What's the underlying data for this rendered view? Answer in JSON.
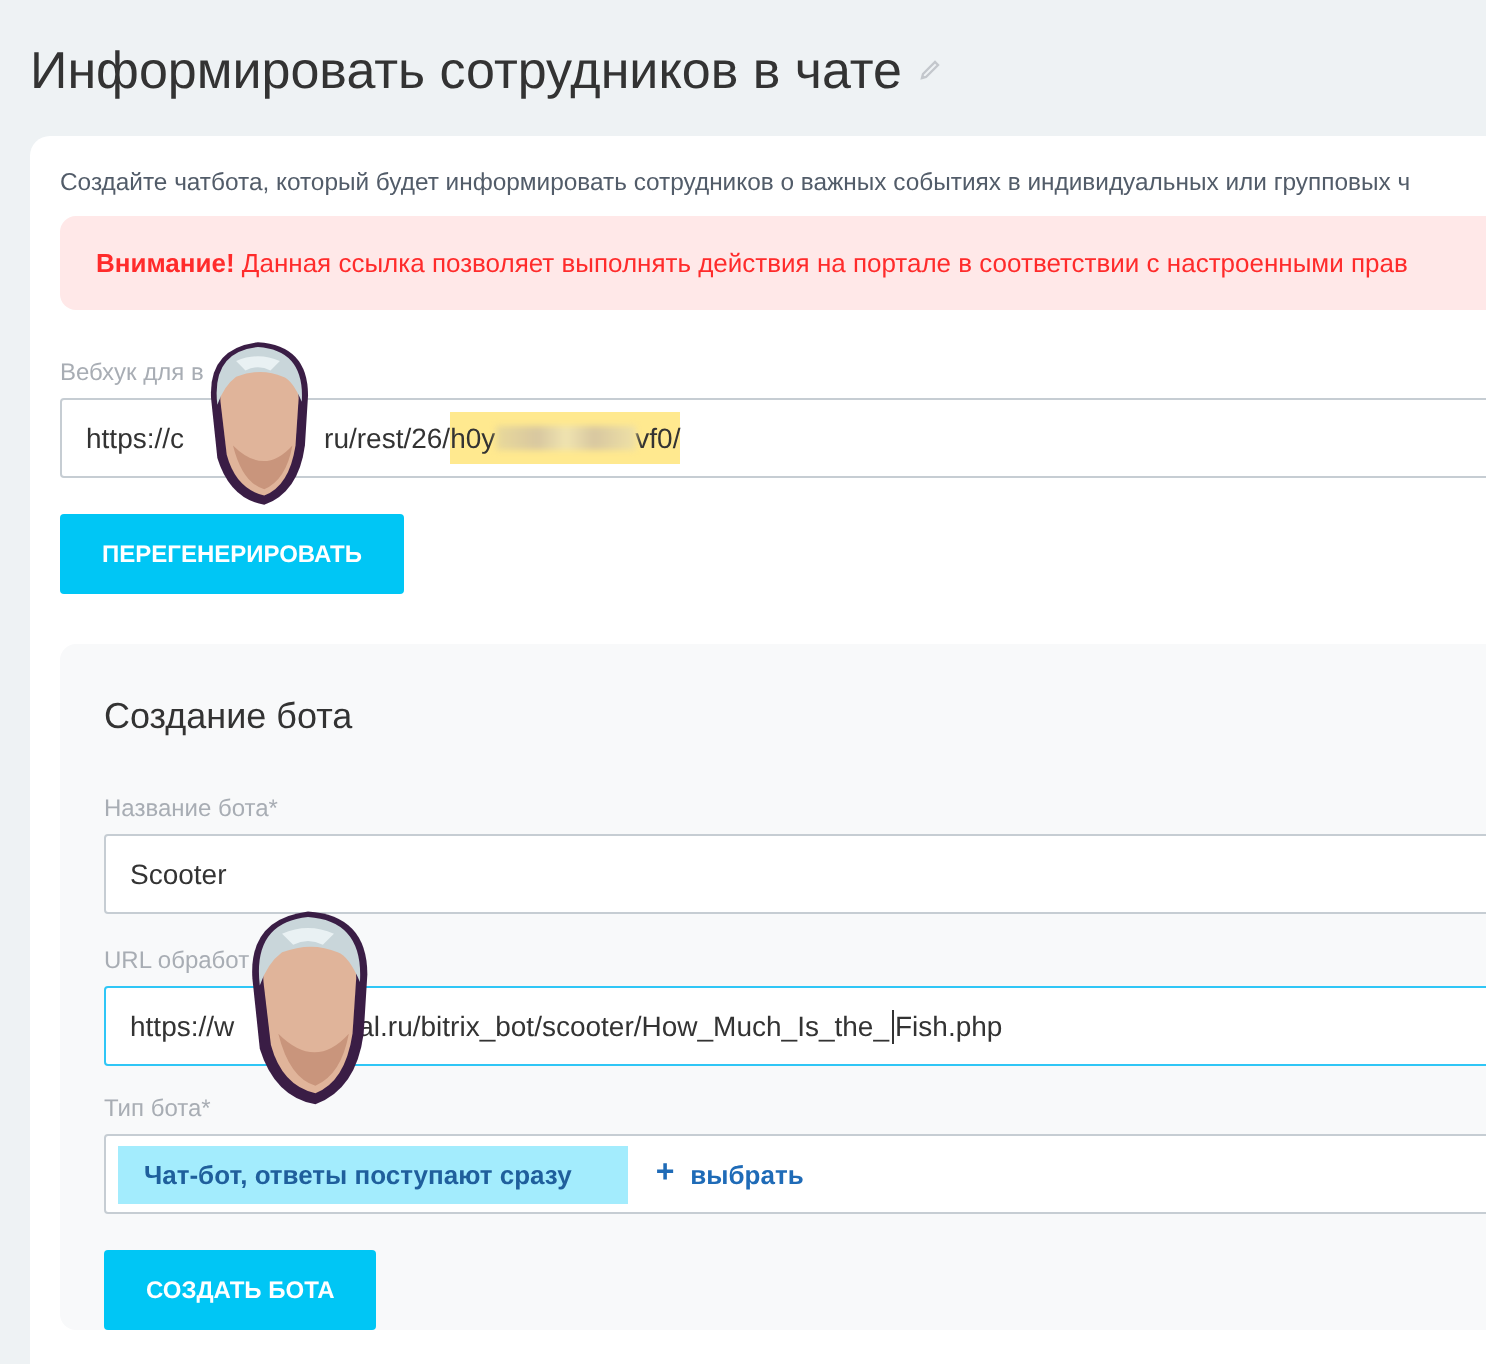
{
  "page_title": "Информировать сотрудников в чате",
  "description": "Создайте чатбота, который будет информировать сотрудников о важных событиях в индивидуальных или групповых ч",
  "alert": "**Внимание!** Данная ссылка позволяет выполнять действия на портале в соответствии с настроенными прав",
  "webhook": {
    "label": "Вебхук для в",
    "value_start": "https://c",
    "value_end": "ru/rest/26/",
    "secret_start": "h0y",
    "secret_end": "vf0/"
  },
  "regenerate_button": "ПЕРЕГЕНЕРИРОВАТЬ",
  "bot_section": {
    "title": "Создание бота",
    "name_field": {
      "label": "Название бота*",
      "value": "Scooter"
    },
    "url_field": {
      "label": "URL обработ",
      "value_start": "https://w",
      "value_end": "al.ru/bitrix_bot/scooter/How_Much_Is_the_",
      "value_tail": "Fish.php",
      "focused": true
    },
    "type_field": {
      "label": "Тип бота*",
      "selected_value": "Чат-бот, ответы поступают сразу",
      "add_symbol": "+",
      "add_link": "выбрать"
    },
    "create_button": "СОЗДАТЬ БОТА"
  }
}
